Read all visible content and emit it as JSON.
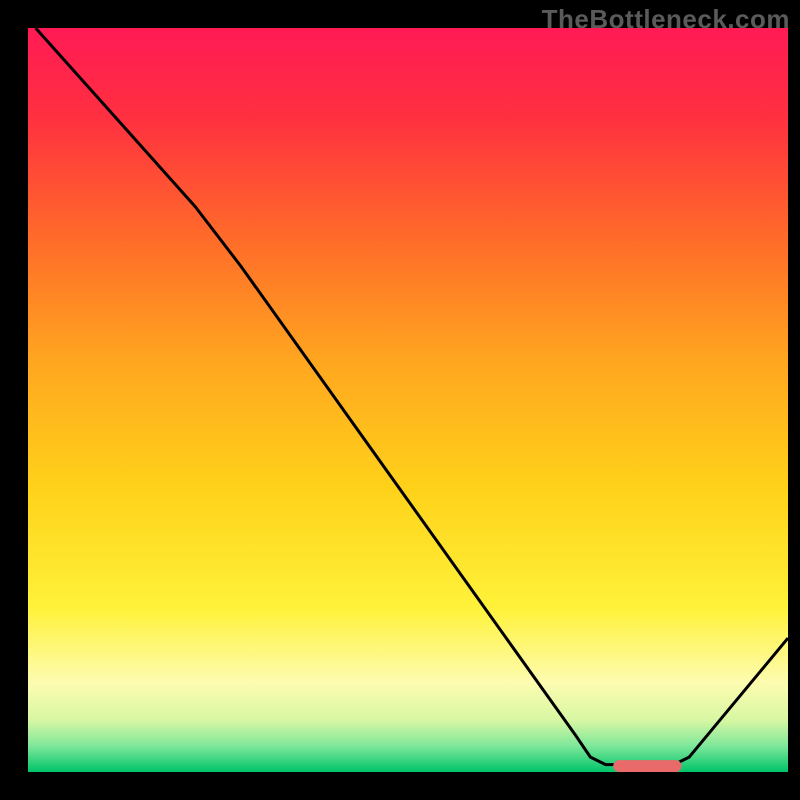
{
  "watermark": "TheBottleneck.com",
  "chart_data": {
    "type": "line",
    "title": "",
    "xlabel": "",
    "ylabel": "",
    "xlim": [
      0,
      100
    ],
    "ylim": [
      0,
      100
    ],
    "gradient_stops": [
      {
        "offset": 0.0,
        "color": "#ff1a55"
      },
      {
        "offset": 0.12,
        "color": "#ff3040"
      },
      {
        "offset": 0.28,
        "color": "#ff6a2a"
      },
      {
        "offset": 0.45,
        "color": "#ffa71f"
      },
      {
        "offset": 0.62,
        "color": "#ffd21a"
      },
      {
        "offset": 0.78,
        "color": "#fff23a"
      },
      {
        "offset": 0.88,
        "color": "#fdfcb0"
      },
      {
        "offset": 0.93,
        "color": "#d8f7a3"
      },
      {
        "offset": 0.965,
        "color": "#7ee79a"
      },
      {
        "offset": 1.0,
        "color": "#00c46a"
      }
    ],
    "series": [
      {
        "name": "bottleneck-curve",
        "stroke": "#000000",
        "points": [
          {
            "x": 1,
            "y": 100
          },
          {
            "x": 22,
            "y": 76
          },
          {
            "x": 28,
            "y": 68
          },
          {
            "x": 72,
            "y": 5
          },
          {
            "x": 74,
            "y": 2
          },
          {
            "x": 76,
            "y": 1
          },
          {
            "x": 85,
            "y": 1
          },
          {
            "x": 87,
            "y": 2
          },
          {
            "x": 100,
            "y": 18
          }
        ]
      }
    ],
    "marker": {
      "name": "optimal-range",
      "color": "#e96a6a",
      "x_start": 77,
      "x_end": 86,
      "y": 0.8,
      "thickness": 1.6
    }
  }
}
